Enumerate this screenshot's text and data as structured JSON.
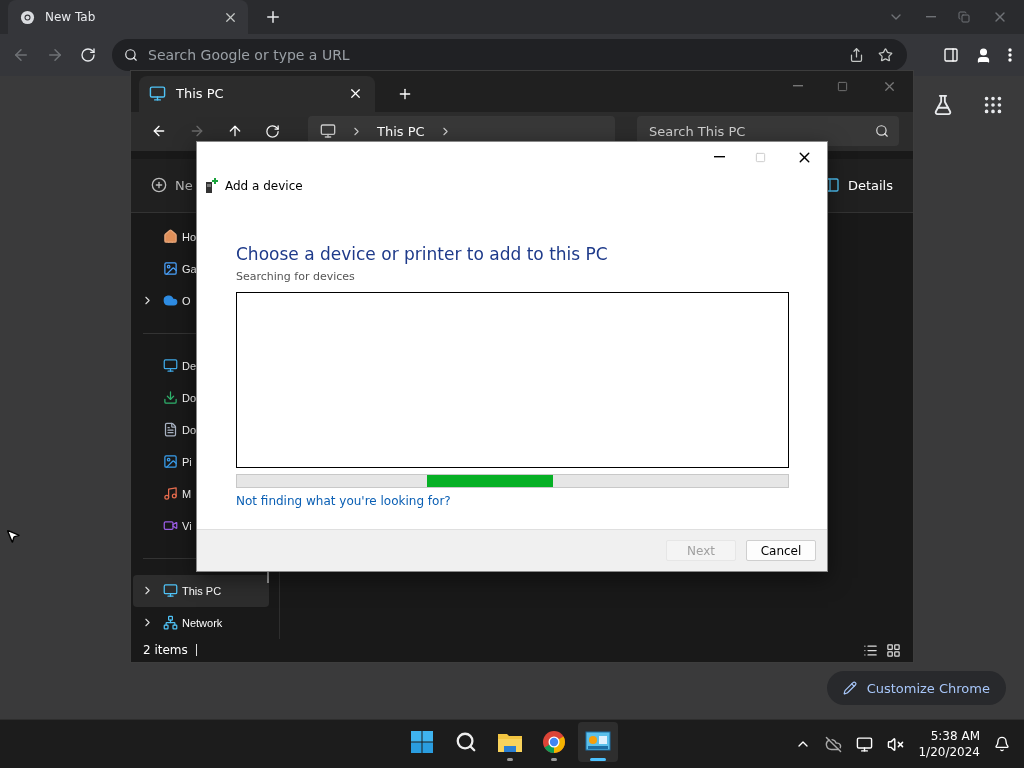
{
  "browser": {
    "tabs": [
      {
        "title": "New Tab",
        "selected": true
      }
    ],
    "nav": {
      "back_enabled": false,
      "forward_enabled": false
    },
    "omnibox": {
      "placeholder": "Search Google or type a URL"
    },
    "customize_button": "Customize Chrome"
  },
  "explorer": {
    "tab": "This PC",
    "nav": {
      "back_enabled": true,
      "forward_enabled": false
    },
    "breadcrumb": [
      "This PC"
    ],
    "search": {
      "placeholder": "Search This PC"
    },
    "toolbar": {
      "new": "Ne",
      "details": "Details"
    },
    "sidebar": [
      [
        {
          "label": "Ho",
          "kind": "home",
          "expandable": false,
          "selected": false
        },
        {
          "label": "Ga",
          "kind": "gallery",
          "expandable": false,
          "selected": false
        },
        {
          "label": "O",
          "kind": "cloud",
          "expandable": true,
          "selected": false
        }
      ],
      [
        {
          "label": "De",
          "kind": "desktop",
          "expandable": false,
          "selected": false
        },
        {
          "label": "Do",
          "kind": "download",
          "expandable": false,
          "selected": false
        },
        {
          "label": "Do",
          "kind": "document",
          "expandable": false,
          "selected": false
        },
        {
          "label": "Pi",
          "kind": "picture",
          "expandable": false,
          "selected": false
        },
        {
          "label": "M",
          "kind": "music",
          "expandable": false,
          "selected": false
        },
        {
          "label": "Vi",
          "kind": "video",
          "expandable": false,
          "selected": false
        }
      ],
      [
        {
          "label": "This PC",
          "kind": "pc",
          "expandable": true,
          "selected": true
        },
        {
          "label": "Network",
          "kind": "network",
          "expandable": true,
          "selected": false
        }
      ]
    ],
    "status": "2 items"
  },
  "dialog": {
    "title": "Add a device",
    "heading": "Choose a device or printer to add to this PC",
    "subheading": "Searching for devices",
    "progress": {
      "kind": "marquee"
    },
    "link": "Not finding what you're looking for?",
    "buttons": [
      {
        "label": "Next",
        "disabled": true
      },
      {
        "label": "Cancel",
        "disabled": false
      }
    ]
  },
  "taskbar": {
    "apps": [
      {
        "kind": "start",
        "running": false,
        "selected": false
      },
      {
        "kind": "search",
        "running": false,
        "selected": false
      },
      {
        "kind": "folder",
        "running": true,
        "selected": false
      },
      {
        "kind": "browser",
        "running": true,
        "selected": false
      },
      {
        "kind": "devices",
        "running": true,
        "selected": true
      }
    ],
    "time": "5:38 AM",
    "date": "1/20/2024"
  }
}
